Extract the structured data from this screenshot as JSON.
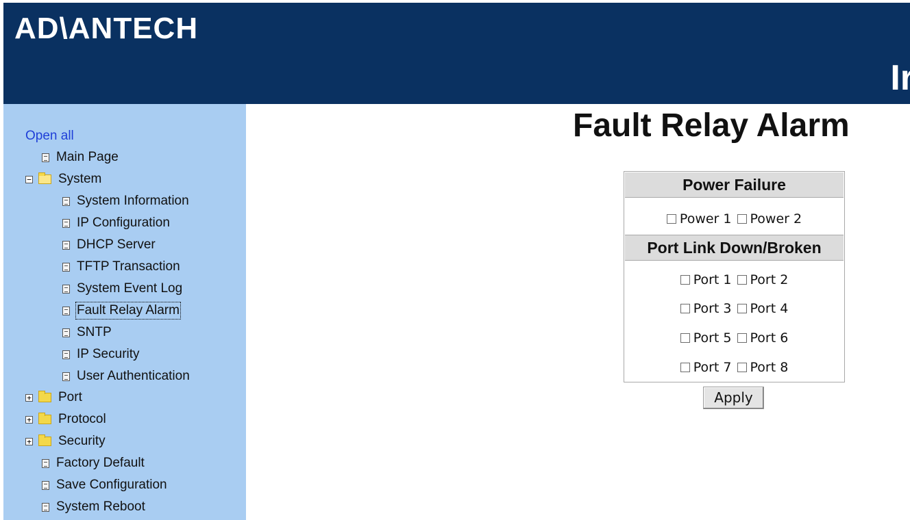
{
  "header": {
    "logo_text": "AD\\ANTECH",
    "cut_title_fragment": "Ir",
    "background": "#0a3161"
  },
  "sidebar": {
    "open_all_label": "Open all",
    "items": [
      {
        "label": "Main Page",
        "icon": "page-icon"
      },
      {
        "label": "System",
        "icon": "folder-open-icon",
        "toggle": "−"
      },
      {
        "label": "System Information",
        "icon": "page-icon"
      },
      {
        "label": "IP Configuration",
        "icon": "page-icon"
      },
      {
        "label": "DHCP Server",
        "icon": "page-icon"
      },
      {
        "label": "TFTP Transaction",
        "icon": "page-icon"
      },
      {
        "label": "System Event Log",
        "icon": "page-icon"
      },
      {
        "label": "Fault Relay Alarm",
        "icon": "page-icon",
        "selected": true
      },
      {
        "label": "SNTP",
        "icon": "page-icon"
      },
      {
        "label": "IP Security",
        "icon": "page-icon"
      },
      {
        "label": "User Authentication",
        "icon": "page-icon"
      },
      {
        "label": "Port",
        "icon": "folder-icon",
        "toggle": "+"
      },
      {
        "label": "Protocol",
        "icon": "folder-icon",
        "toggle": "+"
      },
      {
        "label": "Security",
        "icon": "folder-icon",
        "toggle": "+"
      },
      {
        "label": "Factory Default",
        "icon": "page-icon"
      },
      {
        "label": "Save Configuration",
        "icon": "page-icon"
      },
      {
        "label": "System Reboot",
        "icon": "page-icon"
      }
    ],
    "background": "#a9cdf2"
  },
  "main": {
    "title": "Fault Relay Alarm",
    "power_failure": {
      "header": "Power Failure",
      "options": [
        {
          "label": "Power 1",
          "checked": false
        },
        {
          "label": "Power 2",
          "checked": false
        }
      ]
    },
    "port_link": {
      "header": "Port Link Down/Broken",
      "options": [
        {
          "label": "Port 1",
          "checked": false
        },
        {
          "label": "Port 2",
          "checked": false
        },
        {
          "label": "Port 3",
          "checked": false
        },
        {
          "label": "Port 4",
          "checked": false
        },
        {
          "label": "Port 5",
          "checked": false
        },
        {
          "label": "Port 6",
          "checked": false
        },
        {
          "label": "Port 7",
          "checked": false
        },
        {
          "label": "Port 8",
          "checked": false
        }
      ]
    },
    "apply_label": "Apply"
  }
}
